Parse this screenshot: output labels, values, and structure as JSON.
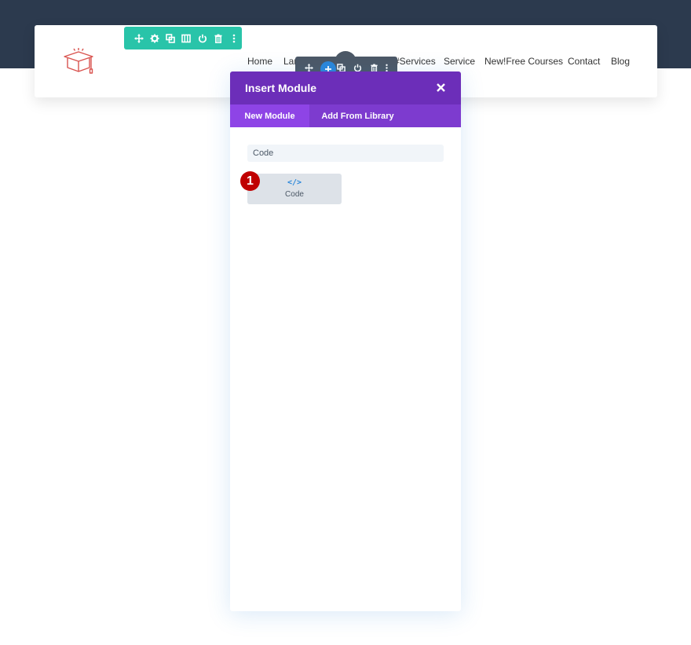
{
  "header": {
    "nav_items": [
      "Home",
      "Lar",
      "#Services",
      "Service",
      "New!Free Courses",
      "Contact",
      "Blog"
    ]
  },
  "row_toolbar": {
    "buttons": [
      "move-icon",
      "gear-icon",
      "duplicate-icon",
      "columns-icon",
      "power-icon",
      "trash-icon",
      "more-icon"
    ]
  },
  "module_toolbar": {
    "buttons": [
      "move-icon",
      "add-icon",
      "duplicate-icon",
      "power-icon",
      "trash-icon",
      "more-icon"
    ]
  },
  "modal": {
    "title": "Insert Module",
    "tabs": [
      {
        "label": "New Module",
        "active": true
      },
      {
        "label": "Add From Library",
        "active": false
      }
    ],
    "search_value": "Code",
    "modules": [
      {
        "glyph": "</>",
        "label": "Code"
      }
    ]
  },
  "annotation": {
    "step_number": "1"
  },
  "colors": {
    "top_band": "#2c3a4e",
    "row_toolbar": "#29c4a9",
    "module_toolbar": "#4c5866",
    "add_button": "#2b87da",
    "modal_header": "#6c2eb9",
    "tab_bar": "#7d3bcf",
    "active_tab": "#8e44e6",
    "step_badge": "#c00000"
  }
}
